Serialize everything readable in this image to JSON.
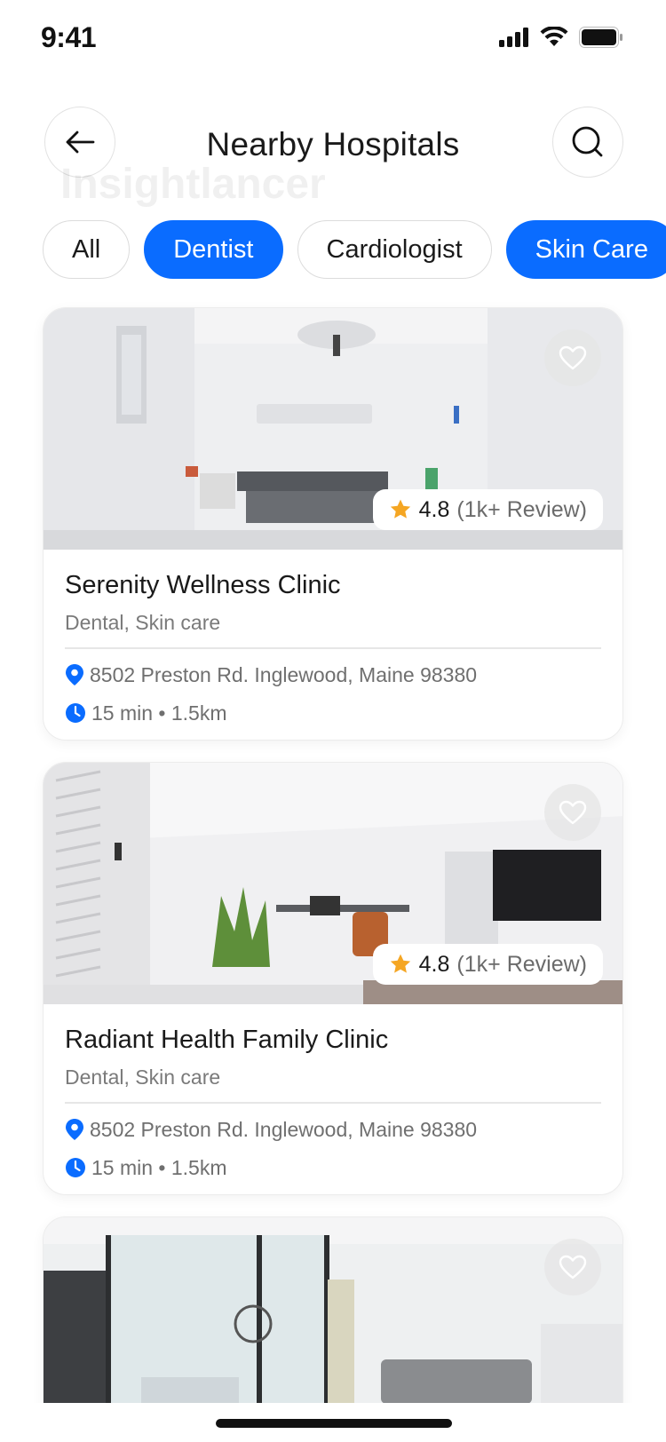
{
  "status_bar": {
    "time": "9:41"
  },
  "header": {
    "title": "Nearby Hospitals",
    "watermark": "Insightlancer"
  },
  "filters": [
    {
      "label": "All",
      "active": false
    },
    {
      "label": "Dentist",
      "active": true
    },
    {
      "label": "Cardiologist",
      "active": false
    },
    {
      "label": "Skin Care",
      "active": true
    }
  ],
  "hospitals": [
    {
      "name": "Serenity Wellness Clinic",
      "specialties": "Dental, Skin care",
      "address": "8502 Preston Rd. Inglewood, Maine 98380",
      "distance": "15 min • 1.5km",
      "rating": "4.8",
      "reviews": "(1k+ Review)"
    },
    {
      "name": "Radiant Health Family Clinic",
      "specialties": "Dental, Skin care",
      "address": "8502 Preston Rd. Inglewood, Maine 98380",
      "distance": "15 min • 1.5km",
      "rating": "4.8",
      "reviews": "(1k+ Review)"
    }
  ],
  "colors": {
    "accent": "#0a6cff",
    "star": "#f5a623"
  },
  "icons": {
    "back": "arrow-left-icon",
    "search": "search-icon",
    "favorite": "heart-icon",
    "rating": "star-icon",
    "location": "location-pin-icon",
    "time": "clock-icon"
  }
}
